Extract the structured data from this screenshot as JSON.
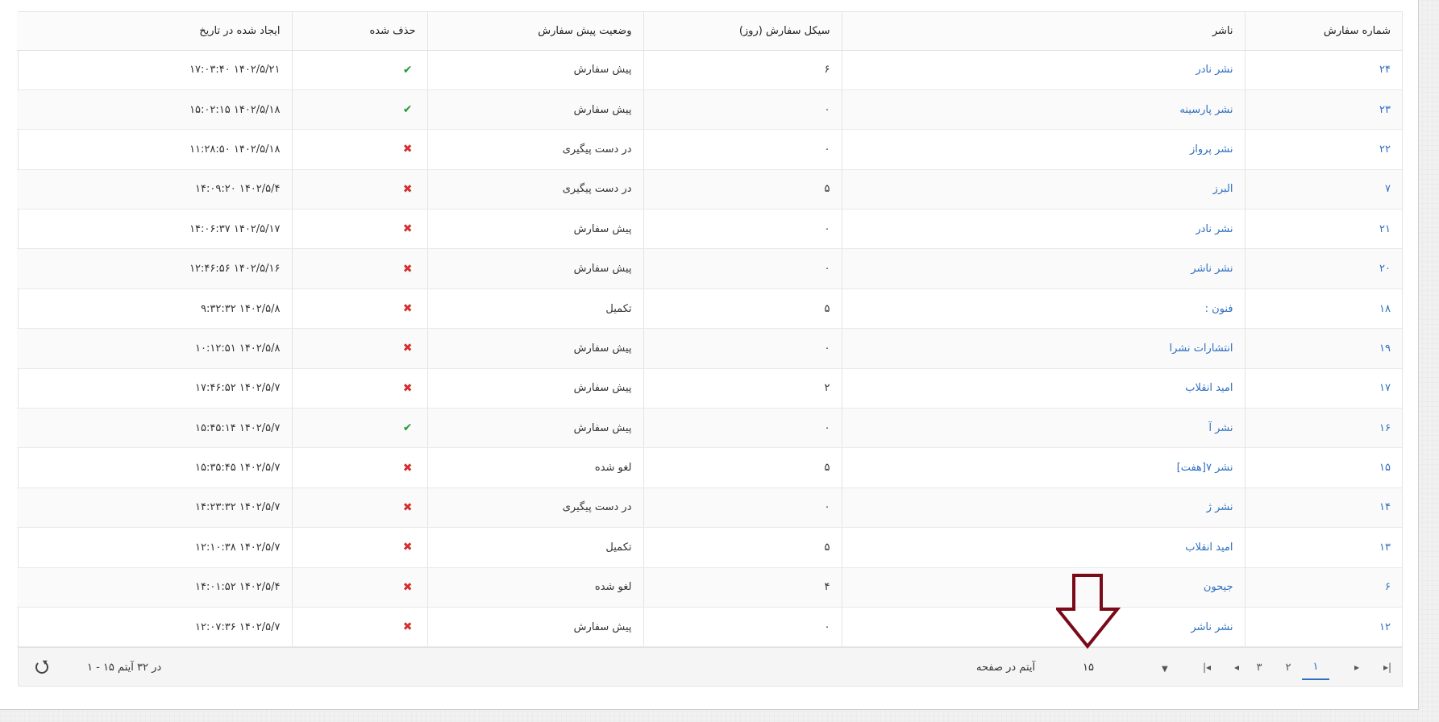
{
  "columns": {
    "order_number": "شماره سفارش",
    "publisher": "ناشر",
    "cycle": "سیکل سفارش (روز)",
    "status": "وضعیت پیش سفارش",
    "deleted": "حذف شده",
    "created": "ایجاد شده در تاریخ"
  },
  "icons": {
    "deleted_true": "check-icon",
    "deleted_false": "cross-icon"
  },
  "colors": {
    "link": "#2f6fbf",
    "check": "#2a9a3a",
    "cross": "#d32f2f",
    "annotation_arrow": "#7a0a1a"
  },
  "rows": [
    {
      "order_number": "۲۴",
      "publisher": "نشر نادر",
      "cycle": "۶",
      "status": "پیش سفارش",
      "deleted": true,
      "created": "۱۴۰۲/۵/۲۱ ۱۷:۰۳:۴۰"
    },
    {
      "order_number": "۲۳",
      "publisher": "نشر پارسینه",
      "cycle": "۰",
      "status": "پیش سفارش",
      "deleted": true,
      "created": "۱۴۰۲/۵/۱۸ ۱۵:۰۲:۱۵"
    },
    {
      "order_number": "۲۲",
      "publisher": "نشر پرواز",
      "cycle": "۰",
      "status": "در دست پیگیری",
      "deleted": false,
      "created": "۱۴۰۲/۵/۱۸ ۱۱:۲۸:۵۰"
    },
    {
      "order_number": "۷",
      "publisher": "البرز",
      "cycle": "۵",
      "status": "در دست پیگیری",
      "deleted": false,
      "created": "۱۴۰۲/۵/۴ ۱۴:۰۹:۲۰"
    },
    {
      "order_number": "۲۱",
      "publisher": "نشر نادر",
      "cycle": "۰",
      "status": "پیش سفارش",
      "deleted": false,
      "created": "۱۴۰۲/۵/۱۷ ۱۴:۰۶:۳۷"
    },
    {
      "order_number": "۲۰",
      "publisher": "نشر ناشر",
      "cycle": "۰",
      "status": "پیش سفارش",
      "deleted": false,
      "created": "۱۴۰۲/۵/۱۶ ۱۲:۴۶:۵۶"
    },
    {
      "order_number": "۱۸",
      "publisher": "فنون :",
      "cycle": "۵",
      "status": "تکمیل",
      "deleted": false,
      "created": "۱۴۰۲/۵/۸ ۹:۳۲:۳۲"
    },
    {
      "order_number": "۱۹",
      "publisher": "انتشارات نشرا",
      "cycle": "۰",
      "status": "پیش سفارش",
      "deleted": false,
      "created": "۱۴۰۲/۵/۸ ۱۰:۱۲:۵۱"
    },
    {
      "order_number": "۱۷",
      "publisher": "امید انقلاب",
      "cycle": "۲",
      "status": "پیش سفارش",
      "deleted": false,
      "created": "۱۴۰۲/۵/۷ ۱۷:۴۶:۵۲"
    },
    {
      "order_number": "۱۶",
      "publisher": "نشر آ",
      "cycle": "۰",
      "status": "پیش سفارش",
      "deleted": true,
      "created": "۱۴۰۲/۵/۷ ۱۵:۴۵:۱۴"
    },
    {
      "order_number": "۱۵",
      "publisher": "نشر ۷[هفت]",
      "cycle": "۵",
      "status": "لغو شده",
      "deleted": false,
      "created": "۱۴۰۲/۵/۷ ۱۵:۳۵:۴۵"
    },
    {
      "order_number": "۱۴",
      "publisher": "نشر ژ",
      "cycle": "۰",
      "status": "در دست پیگیری",
      "deleted": false,
      "created": "۱۴۰۲/۵/۷ ۱۴:۲۳:۳۲"
    },
    {
      "order_number": "۱۳",
      "publisher": "امید انقلاب",
      "cycle": "۵",
      "status": "تکمیل",
      "deleted": false,
      "created": "۱۴۰۲/۵/۷ ۱۲:۱۰:۳۸"
    },
    {
      "order_number": "۶",
      "publisher": "جیحون",
      "cycle": "۴",
      "status": "لغو شده",
      "deleted": false,
      "created": "۱۴۰۲/۵/۴ ۱۴:۰۱:۵۲"
    },
    {
      "order_number": "۱۲",
      "publisher": "نشر ناشر",
      "cycle": "۰",
      "status": "پیش سفارش",
      "deleted": false,
      "created": "۱۴۰۲/۵/۷ ۱۲:۰۷:۳۶"
    }
  ],
  "pager": {
    "first_icon": "first-page-icon",
    "prev_icon": "prev-page-icon",
    "next_icon": "next-page-icon",
    "last_icon": "last-page-icon",
    "pages": [
      "۳",
      "۲",
      "۱"
    ],
    "active_page": "۱",
    "page_size": "۱۵",
    "page_size_label": "آیتم در صفحه",
    "summary": "۱ - ۱۵ در ۳۲ آیتم",
    "refresh_icon": "refresh-icon"
  }
}
